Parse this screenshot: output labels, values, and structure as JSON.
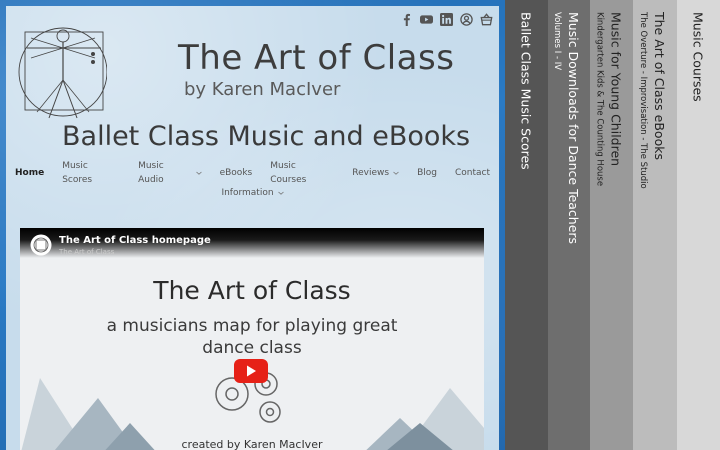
{
  "site": {
    "title": "The Art of Class",
    "byline": "by Karen MacIver",
    "subtitle": "Ballet Class Music and eBooks"
  },
  "social": [
    "facebook-icon",
    "youtube-icon",
    "linkedin-icon",
    "account-icon",
    "basket-icon"
  ],
  "nav": {
    "row1": [
      {
        "label": "Home",
        "dropdown": false
      },
      {
        "label": "Music Scores",
        "dropdown": false
      },
      {
        "label": "Music Audio",
        "dropdown": true
      },
      {
        "label": "eBooks",
        "dropdown": false
      },
      {
        "label": "Music Courses",
        "dropdown": false
      },
      {
        "label": "Reviews",
        "dropdown": true
      },
      {
        "label": "Blog",
        "dropdown": false
      },
      {
        "label": "Contact",
        "dropdown": false
      }
    ],
    "row2": [
      {
        "label": "Information",
        "dropdown": true
      }
    ]
  },
  "video": {
    "channel_title": "The Art of Class homepage",
    "channel_sub": "The Art of Class",
    "heading": "The Art of Class",
    "tagline1": "a musicians map for playing great",
    "tagline2": "dance class",
    "credit": "created by Karen MacIver"
  },
  "tabs": [
    {
      "title": "Ballet Class Music Scores",
      "sub": "",
      "bg": "#555555",
      "color": "#ffffff"
    },
    {
      "title": "Music Downloads for Dance Teachers",
      "sub": "Volumes I - IV",
      "bg": "#6e6e6e",
      "color": "#ffffff"
    },
    {
      "title": "Music for Young Children",
      "sub": "Kindergarten Kids & The Counting House",
      "bg": "#9a9a9a",
      "color": "#222222"
    },
    {
      "title": "The Art of Class eBooks",
      "sub": "The Overture - Improvisation - The Studio",
      "bg": "#bcbcbc",
      "color": "#222222"
    },
    {
      "title": "Music Courses",
      "sub": "",
      "bg": "#d8d8d8",
      "color": "#222222"
    }
  ],
  "colors": {
    "accent": "#1d63a8",
    "play": "#e62117"
  }
}
